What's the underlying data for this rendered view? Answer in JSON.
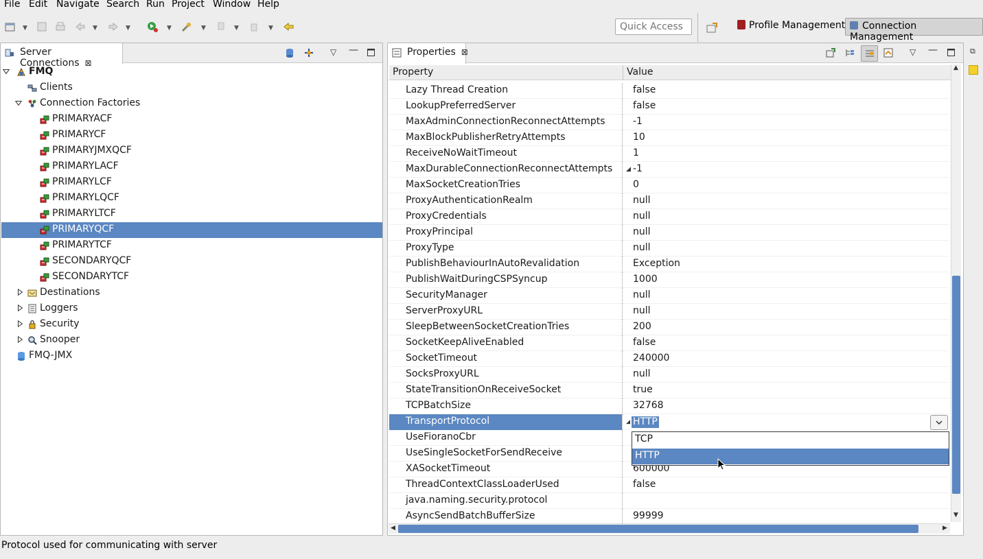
{
  "menu": [
    "File",
    "Edit",
    "Navigate",
    "Search",
    "Run",
    "Project",
    "Window",
    "Help"
  ],
  "toolbar": {
    "quick_access_placeholder": "Quick Access",
    "perspective_profile": "Profile Management",
    "perspective_connection": "Connection Management"
  },
  "left_panel": {
    "title": "Server Connections",
    "tree": [
      {
        "label": "FMQ",
        "level": 0,
        "expanded": true,
        "bold": true,
        "icon": "server-icon"
      },
      {
        "label": "Clients",
        "level": 1,
        "icon": "clients-icon"
      },
      {
        "label": "Connection Factories",
        "level": 1,
        "expanded": true,
        "icon": "factories-icon"
      },
      {
        "label": "PRIMARYACF",
        "level": 2,
        "icon": "factory-icon"
      },
      {
        "label": "PRIMARYCF",
        "level": 2,
        "icon": "factory-icon"
      },
      {
        "label": "PRIMARYJMXQCF",
        "level": 2,
        "icon": "factory-icon"
      },
      {
        "label": "PRIMARYLACF",
        "level": 2,
        "icon": "factory-icon"
      },
      {
        "label": "PRIMARYLCF",
        "level": 2,
        "icon": "factory-icon"
      },
      {
        "label": "PRIMARYLQCF",
        "level": 2,
        "icon": "factory-icon"
      },
      {
        "label": "PRIMARYLTCF",
        "level": 2,
        "icon": "factory-icon"
      },
      {
        "label": "PRIMARYQCF",
        "level": 2,
        "icon": "factory-icon",
        "selected": true
      },
      {
        "label": "PRIMARYTCF",
        "level": 2,
        "icon": "factory-icon"
      },
      {
        "label": "SECONDARYQCF",
        "level": 2,
        "icon": "factory-icon"
      },
      {
        "label": "SECONDARYTCF",
        "level": 2,
        "icon": "factory-icon"
      },
      {
        "label": "Destinations",
        "level": 1,
        "expanded": false,
        "icon": "destinations-icon"
      },
      {
        "label": "Loggers",
        "level": 1,
        "expanded": false,
        "icon": "loggers-icon"
      },
      {
        "label": "Security",
        "level": 1,
        "expanded": false,
        "icon": "security-icon"
      },
      {
        "label": "Snooper",
        "level": 1,
        "expanded": false,
        "icon": "snooper-icon"
      },
      {
        "label": "FMQ-JMX",
        "level": 0,
        "icon": "jmx-server-icon"
      }
    ]
  },
  "right_panel": {
    "title": "Properties",
    "col_property": "Property",
    "col_value": "Value",
    "rows": [
      {
        "name": "Lazy Thread Creation",
        "value": "false"
      },
      {
        "name": "LookupPreferredServer",
        "value": "false"
      },
      {
        "name": "MaxAdminConnectionReconnectAttempts",
        "value": "-1"
      },
      {
        "name": "MaxBlockPublisherRetryAttempts",
        "value": "10"
      },
      {
        "name": "ReceiveNoWaitTimeout",
        "value": "1"
      },
      {
        "name": "MaxDurableConnectionReconnectAttempts",
        "value": "-1",
        "marker": true
      },
      {
        "name": "MaxSocketCreationTries",
        "value": "0"
      },
      {
        "name": "ProxyAuthenticationRealm",
        "value": "null"
      },
      {
        "name": "ProxyCredentials",
        "value": "null"
      },
      {
        "name": "ProxyPrincipal",
        "value": "null"
      },
      {
        "name": "ProxyType",
        "value": "null"
      },
      {
        "name": "PublishBehaviourInAutoRevalidation",
        "value": "Exception"
      },
      {
        "name": "PublishWaitDuringCSPSyncup",
        "value": "1000"
      },
      {
        "name": "SecurityManager",
        "value": "null"
      },
      {
        "name": "ServerProxyURL",
        "value": "null"
      },
      {
        "name": "SleepBetweenSocketCreationTries",
        "value": "200"
      },
      {
        "name": "SocketKeepAliveEnabled",
        "value": "false"
      },
      {
        "name": "SocketTimeout",
        "value": "240000"
      },
      {
        "name": "SocksProxyURL",
        "value": "null"
      },
      {
        "name": "StateTransitionOnReceiveSocket",
        "value": "true"
      },
      {
        "name": "TCPBatchSize",
        "value": "32768"
      },
      {
        "name": "TransportProtocol",
        "value": "",
        "selected": true,
        "marker": true
      },
      {
        "name": "UseFioranoCbr",
        "value": ""
      },
      {
        "name": "UseSingleSocketForSendReceive",
        "value": ""
      },
      {
        "name": "XASocketTimeout",
        "value": "600000"
      },
      {
        "name": "ThreadContextClassLoaderUsed",
        "value": "false"
      },
      {
        "name": "java.naming.security.protocol",
        "value": ""
      },
      {
        "name": "AsyncSendBatchBufferSize",
        "value": "99999"
      }
    ],
    "combo": {
      "current": "HTTP",
      "options": [
        "TCP",
        "HTTP"
      ],
      "selected_index": 1
    },
    "vscroll_fraction": 0.48,
    "hscroll_fraction": 0.95
  },
  "status": "Protocol used for communicating with server"
}
